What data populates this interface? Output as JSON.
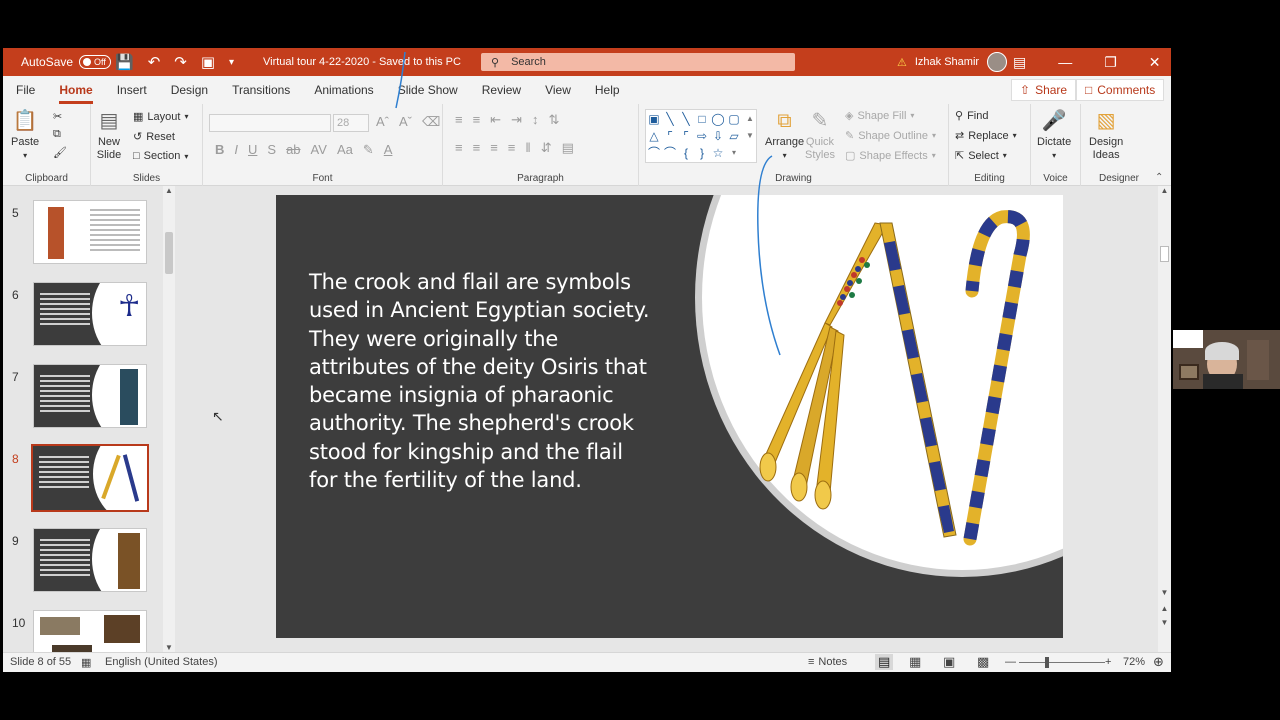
{
  "titlebar": {
    "autosave_label": "AutoSave",
    "autosave_state": "Off",
    "document_title": "Virtual tour 4-22-2020  -  Saved to this PC",
    "search_placeholder": "Search",
    "user_name": "Izhak Shamir"
  },
  "menu": {
    "items": [
      "File",
      "Home",
      "Insert",
      "Design",
      "Transitions",
      "Animations",
      "Slide Show",
      "Review",
      "View",
      "Help"
    ],
    "active": "Home",
    "share_label": "Share",
    "comments_label": "Comments"
  },
  "ribbon": {
    "clipboard": {
      "paste": "Paste",
      "group": "Clipboard"
    },
    "slides": {
      "new_slide_1": "New",
      "new_slide_2": "Slide",
      "layout": "Layout",
      "reset": "Reset",
      "section": "Section",
      "group": "Slides"
    },
    "font": {
      "size": "28",
      "group": "Font"
    },
    "paragraph": {
      "group": "Paragraph"
    },
    "drawing": {
      "arrange": "Arrange",
      "quick_styles_1": "Quick",
      "quick_styles_2": "Styles",
      "shape_fill": "Shape Fill",
      "shape_outline": "Shape Outline",
      "shape_effects": "Shape Effects",
      "group": "Drawing"
    },
    "editing": {
      "find": "Find",
      "replace": "Replace",
      "select": "Select",
      "group": "Editing"
    },
    "voice": {
      "dictate": "Dictate",
      "group": "Voice"
    },
    "designer": {
      "design_ideas_1": "Design",
      "design_ideas_2": "Ideas",
      "group": "Designer"
    }
  },
  "thumbnails": [
    {
      "number": "5",
      "theme": "light"
    },
    {
      "number": "6",
      "theme": "dark"
    },
    {
      "number": "7",
      "theme": "dark"
    },
    {
      "number": "8",
      "theme": "dark",
      "selected": true
    },
    {
      "number": "9",
      "theme": "dark"
    },
    {
      "number": "10",
      "theme": "light"
    }
  ],
  "slide": {
    "lines": [
      "The crook and flail are symbols",
      "used in Ancient Egyptian society.",
      "They were originally the",
      "attributes of the deity Osiris that",
      "became insignia of pharaonic",
      "authority. The shepherd's crook",
      "stood for kingship and the flail",
      "for the fertility of the land."
    ]
  },
  "statusbar": {
    "slide_counter": "Slide 8 of 55",
    "language": "English (United States)",
    "notes": "Notes",
    "zoom": "72%"
  },
  "colors": {
    "accent": "#c43e1c",
    "slide_bg": "#3d3d3d",
    "gold": "#e3b22a",
    "blue": "#2a3a8c"
  }
}
